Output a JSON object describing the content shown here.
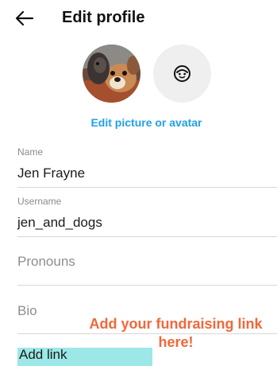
{
  "header": {
    "title": "Edit profile",
    "back_icon": "arrow-left-icon"
  },
  "profile_picture": {
    "avatar_icon": "avatar-face-icon",
    "edit_label": "Edit picture or avatar"
  },
  "fields": {
    "name": {
      "label": "Name",
      "value": "Jen Frayne"
    },
    "username": {
      "label": "Username",
      "value": "jen_and_dogs"
    },
    "pronouns": {
      "placeholder": "Pronouns"
    },
    "bio": {
      "placeholder": "Bio"
    }
  },
  "add_link": {
    "label": "Add link"
  },
  "annotation": {
    "line1": "Add your fundraising link",
    "line2": "here!",
    "color": "#f2673a",
    "highlight_color": "#9be8e6"
  },
  "colors": {
    "accent": "#1fa1ea",
    "divider": "#d7d7d7",
    "muted": "#8a8a8a"
  }
}
